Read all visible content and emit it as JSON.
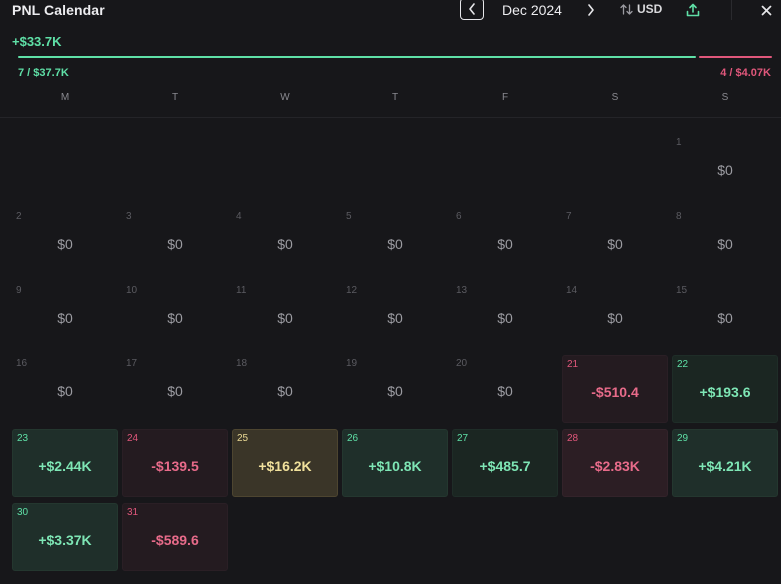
{
  "header": {
    "title": "PNL Calendar",
    "month": "Dec 2024",
    "currency": "USD",
    "prev_icon": "chevron-left-icon",
    "next_icon": "chevron-right-icon",
    "sort_icon": "sort-arrows-icon",
    "export_icon": "upload-icon",
    "close_icon": "close-icon"
  },
  "summary": {
    "total": "+$33.7K",
    "wins": "7 / $37.7K",
    "losses": "4 / $4.07K",
    "win_share": 0.9026
  },
  "weekdays": [
    "M",
    "T",
    "W",
    "T",
    "F",
    "S",
    "S"
  ],
  "days": [
    {
      "day": "1",
      "value": "$0"
    },
    {
      "day": "2",
      "value": "$0"
    },
    {
      "day": "3",
      "value": "$0"
    },
    {
      "day": "4",
      "value": "$0"
    },
    {
      "day": "5",
      "value": "$0"
    },
    {
      "day": "6",
      "value": "$0"
    },
    {
      "day": "7",
      "value": "$0"
    },
    {
      "day": "8",
      "value": "$0"
    },
    {
      "day": "9",
      "value": "$0"
    },
    {
      "day": "10",
      "value": "$0"
    },
    {
      "day": "11",
      "value": "$0"
    },
    {
      "day": "12",
      "value": "$0"
    },
    {
      "day": "13",
      "value": "$0"
    },
    {
      "day": "14",
      "value": "$0"
    },
    {
      "day": "15",
      "value": "$0"
    },
    {
      "day": "16",
      "value": "$0"
    },
    {
      "day": "17",
      "value": "$0"
    },
    {
      "day": "18",
      "value": "$0"
    },
    {
      "day": "19",
      "value": "$0"
    },
    {
      "day": "20",
      "value": "$0"
    },
    {
      "day": "21",
      "value": "-$510.4"
    },
    {
      "day": "22",
      "value": "+$193.6"
    },
    {
      "day": "23",
      "value": "+$2.44K"
    },
    {
      "day": "24",
      "value": "-$139.5"
    },
    {
      "day": "25",
      "value": "+$16.2K"
    },
    {
      "day": "26",
      "value": "+$10.8K"
    },
    {
      "day": "27",
      "value": "+$485.7"
    },
    {
      "day": "28",
      "value": "-$2.83K"
    },
    {
      "day": "29",
      "value": "+$4.21K"
    },
    {
      "day": "30",
      "value": "+$3.37K"
    },
    {
      "day": "31",
      "value": "-$589.6"
    }
  ],
  "colors": {
    "positive": "#5fe0a7",
    "negative": "#e0577b",
    "best": "#f1e19c",
    "background": "#17171a"
  }
}
